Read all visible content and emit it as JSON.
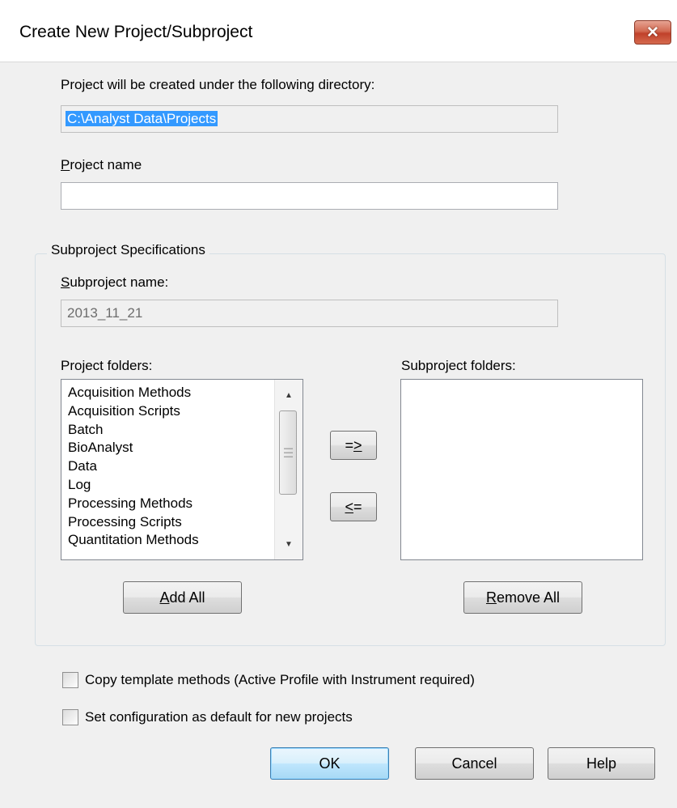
{
  "window": {
    "title": "Create New Project/Subproject",
    "close_glyph": "✕"
  },
  "directory": {
    "label": "Project will be created under the following directory:",
    "value": "C:\\Analyst Data\\Projects"
  },
  "project_name": {
    "label_mnemonic": "P",
    "label_rest": "roject name",
    "value": ""
  },
  "subproject_spec": {
    "legend": "Subproject Specifications",
    "subproject_name": {
      "label_mnemonic": "S",
      "label_rest": "ubproject name:",
      "value": "2013_11_21"
    },
    "project_folders": {
      "label": "Project folders:",
      "items": [
        "Acquisition Methods",
        "Acquisition Scripts",
        "Batch",
        "BioAnalyst",
        "Data",
        "Log",
        "Processing Methods",
        "Processing Scripts",
        "Quantitation Methods"
      ]
    },
    "subproject_folders": {
      "label": "Subproject folders:",
      "items": []
    },
    "move_right": {
      "pre": "=",
      "mnemonic": ">"
    },
    "move_left": {
      "mnemonic": "<",
      "post": "="
    },
    "add_all": {
      "mnemonic": "A",
      "rest": "dd All"
    },
    "remove_all": {
      "mnemonic": "R",
      "rest": "emove All"
    }
  },
  "options": {
    "copy_template": {
      "label": "Copy template methods (Active Profile with Instrument required)",
      "checked": false
    },
    "set_default": {
      "label": "Set configuration as default for new projects",
      "checked": false
    }
  },
  "buttons": {
    "ok": "OK",
    "cancel": "Cancel",
    "help": "Help"
  },
  "colors": {
    "dialog_bg": "#f0f0f0",
    "selection": "#3399ff",
    "close_button": "#c74b33",
    "default_button_border": "#3c7fb1"
  },
  "icons": {
    "close": "close-icon",
    "scroll_up": "scroll-up-arrow-icon",
    "scroll_down": "scroll-down-arrow-icon"
  }
}
